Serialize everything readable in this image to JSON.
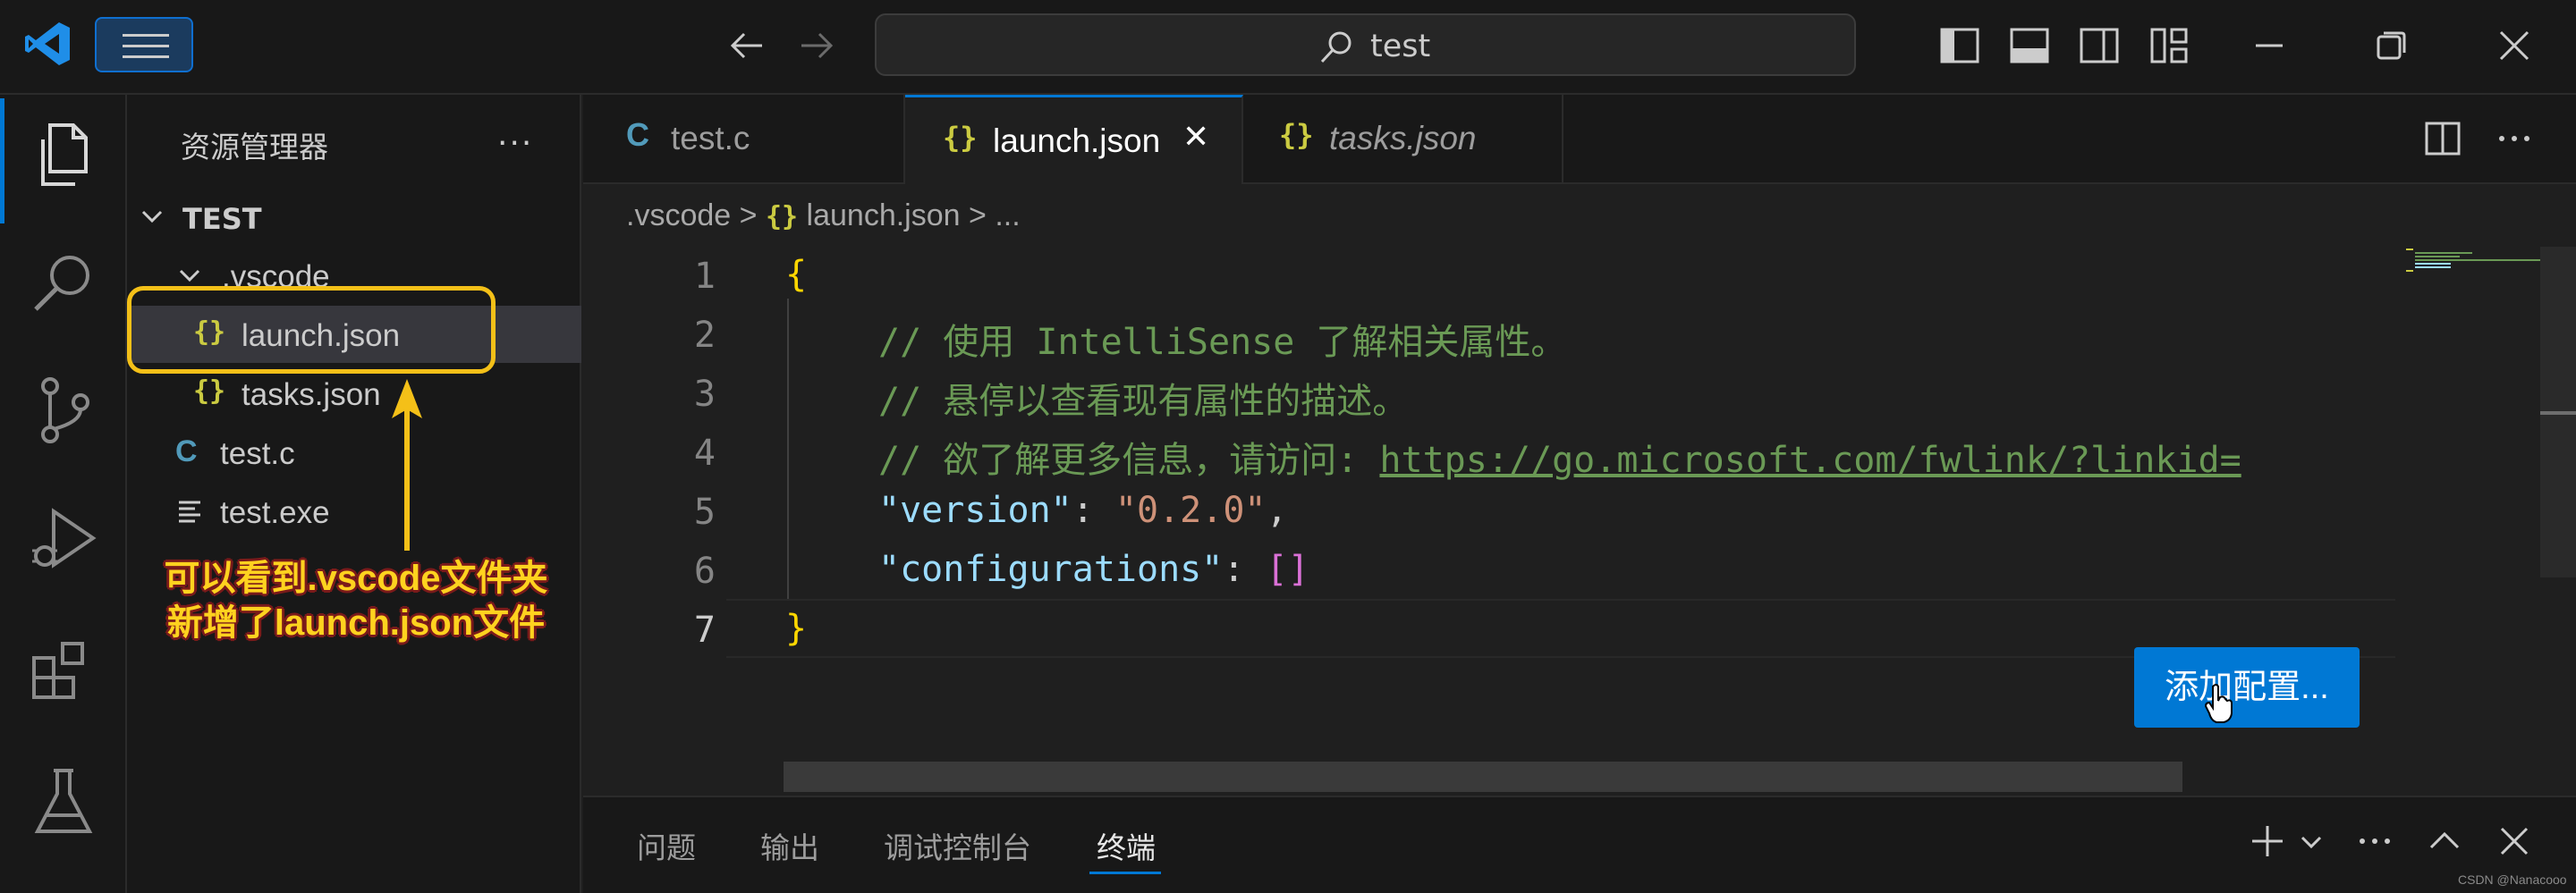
{
  "titlebar": {
    "search_text": "test"
  },
  "sidebar": {
    "title": "资源管理器",
    "more": "···",
    "folder": "TEST",
    "tree": [
      {
        "label": ".vscode",
        "kind": "folder"
      },
      {
        "label": "launch.json",
        "kind": "json",
        "selected": true
      },
      {
        "label": "tasks.json",
        "kind": "json"
      },
      {
        "label": "test.c",
        "kind": "c"
      },
      {
        "label": "test.exe",
        "kind": "file"
      }
    ],
    "json_glyph": "{}",
    "c_glyph": "C"
  },
  "annotation": {
    "line1": "可以看到.vscode文件夹",
    "line2": "新增了launch.json文件",
    "color": "#f4c018"
  },
  "tabs": [
    {
      "label": "test.c",
      "icon": "C"
    },
    {
      "label": "launch.json",
      "icon": "{}",
      "active": true,
      "close": "✕"
    },
    {
      "label": "tasks.json",
      "icon": "{}",
      "italic": true
    }
  ],
  "breadcrumb": {
    "folder": ".vscode",
    "sep": ">",
    "file": "launch.json",
    "tail": "..."
  },
  "editor": {
    "line_numbers": [
      "1",
      "2",
      "3",
      "4",
      "5",
      "6",
      "7"
    ],
    "comment1": "// 使用 IntelliSense 了解相关属性。",
    "comment2": "// 悬停以查看现有属性的描述。",
    "comment3_prefix": "// 欲了解更多信息，请访问: ",
    "comment3_link": "https://go.microsoft.com/fwlink/?linkid=",
    "version_key": "\"version\"",
    "version_value": "\"0.2.0\"",
    "config_key": "\"configurations\"",
    "config_value": "[]",
    "open_brace": "{",
    "close_brace": "}",
    "colon": ": ",
    "comma": ","
  },
  "add_config_button": "添加配置...",
  "panel": {
    "tabs": [
      "问题",
      "输出",
      "调试控制台",
      "终端"
    ],
    "active_tab": "终端"
  },
  "watermark": "CSDN @Nanacooo",
  "colors": {
    "accent": "#0078d4",
    "json_icon": "#cbcb41",
    "c_icon": "#519aba",
    "comment": "#6a9955",
    "key": "#9cdcfe",
    "string": "#ce9178"
  }
}
